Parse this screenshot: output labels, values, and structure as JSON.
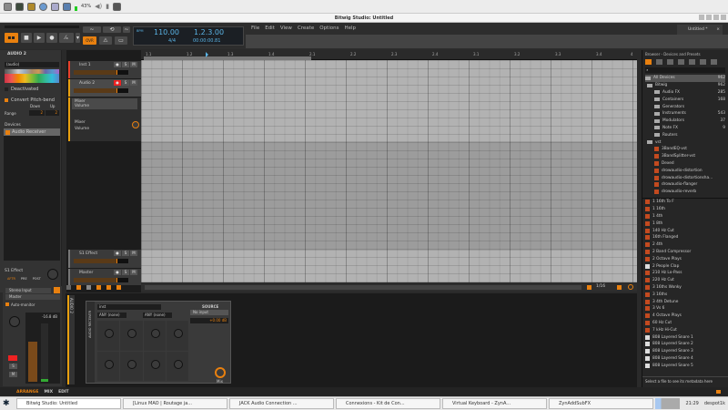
{
  "system_bar": {
    "battery": "43%"
  },
  "window": {
    "title": "Bitwig Studio: Untitled"
  },
  "transport": {
    "tempo": "110.00",
    "time_signature": "4/4",
    "position": "1.2.3.00",
    "time": "00:00:00.81",
    "tempo_label": "BPM",
    "ovr": "OVR"
  },
  "menu": [
    "File",
    "Edit",
    "View",
    "Create",
    "Options",
    "Help"
  ],
  "project_tab": "Untitled *",
  "inspector": {
    "track_title": "AUDIO 2",
    "track_name": "(audio)",
    "deactivated": "Deactivated",
    "pitch_bend": "Convert Pitch-bend",
    "down": "Down",
    "up": "Up",
    "range": "Range",
    "range_down": "2",
    "range_up": "2",
    "devices_label": "Devices",
    "device": "Audio Receiver",
    "send_label": "S1 Effect",
    "send_modes": [
      "AFTR",
      "PRE",
      "POST"
    ],
    "input": "Stereo Input",
    "output": "Master",
    "auto_monitor": "Auto-monitor",
    "level": "-16.8 dB",
    "meter_ticks": [
      "0",
      "3",
      "6",
      "12",
      "18",
      "24",
      "30",
      "36",
      "42",
      "48",
      "60"
    ],
    "solo": "S",
    "mute": "M"
  },
  "tracks": [
    {
      "name": "Inst 1",
      "color": "#e8402a"
    },
    {
      "name": "Audio 2",
      "color": "#e8a00f"
    },
    {
      "name": "S1 Effect",
      "color": "#888888"
    },
    {
      "name": "Master",
      "color": "#888888"
    }
  ],
  "automation": {
    "lane1_device": "Mixer",
    "lane1_param": "Volume",
    "lane2_device": "Mixer",
    "lane2_param": "Volume"
  },
  "ruler": [
    "1.1",
    "1.2",
    "1.3",
    "1.4",
    "2.1",
    "2.2",
    "2.3",
    "2.4",
    "3.1",
    "3.2",
    "3.3",
    "3.4",
    "4"
  ],
  "arranger_footer": {
    "zoom": "1/16"
  },
  "device_panel": {
    "track_label": "AUDIO 2",
    "device_title": "AUDIO RECEIVER",
    "input_text": "inst",
    "filter1": "ANY (none)",
    "filter2": "ANY (none)",
    "source_label": "SOURCE",
    "source_value": "No input",
    "gain": "+0.00 dB",
    "mix": "Mix"
  },
  "browser": {
    "title": "Browser - Devices and Presets",
    "tree": [
      {
        "label": "All Devices",
        "count": "962"
      },
      {
        "label": "Bitwig",
        "count": "962"
      },
      {
        "label": "Audio FX",
        "count": "285"
      },
      {
        "label": "Containers",
        "count": "168"
      },
      {
        "label": "Generators",
        "count": ""
      },
      {
        "label": "Instruments",
        "count": "543"
      },
      {
        "label": "Modulators",
        "count": "37"
      },
      {
        "label": "Note FX",
        "count": "9"
      },
      {
        "label": "Routers",
        "count": ""
      },
      {
        "label": "vst",
        "count": ""
      },
      {
        "label": "3BandEQ-vst",
        "count": ""
      },
      {
        "label": "3BandSplitter-vst",
        "count": ""
      },
      {
        "label": "Dexed",
        "count": ""
      },
      {
        "label": "drowaudio-distortion",
        "count": ""
      },
      {
        "label": "drowaudio-distortionsha...",
        "count": ""
      },
      {
        "label": "drowaudio-flanger",
        "count": ""
      },
      {
        "label": "drowaudio-reverb",
        "count": ""
      }
    ],
    "presets": [
      "1 16th To F",
      "1 16th",
      "1 4th",
      "1 8th",
      "140 Hz Cut",
      "16th Flanged",
      "2 4th",
      "2 Band Compressor",
      "2 Octave Plays",
      "2 People Clap",
      "210 Hz Lo-Pass",
      "220 Hz Cut",
      "3 16ths Wonky",
      "3 16ths",
      "3 4th Detune",
      "3 Vs 6",
      "4 Octave Plays",
      "60 Hz Cut",
      "7 kHz Hi-Cut",
      "808 Layered Snare 1",
      "808 Layered Snare 2",
      "808 Layered Snare 3",
      "808 Layered Snare 4",
      "808 Layered Snare 5"
    ],
    "metadata_hint": "Select a file to see its metadata here"
  },
  "footer": {
    "tabs": [
      "ARRANGE",
      "MIX",
      "EDIT"
    ]
  },
  "taskbar": {
    "tasks": [
      "Bitwig Studio: Untitled",
      "[Linux MAO | Routage ja...",
      "JACK Audio Connection ...",
      "Connexions - Kit de Con...",
      "Virtual Keyboard - ZynA...",
      "ZynAddSubFX"
    ],
    "clock": "21:29",
    "user": "despot1k"
  },
  "colors": {
    "accent": "#e8800f",
    "lcd": "#5ab4e6",
    "grid": "#b2b2b2"
  }
}
